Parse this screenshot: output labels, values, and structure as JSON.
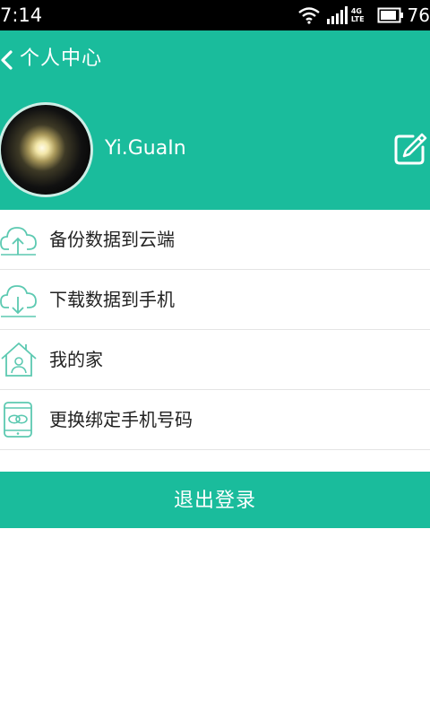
{
  "status_bar": {
    "time": "7:14",
    "network": "4G",
    "network_sub": "LTE",
    "battery": "76"
  },
  "header": {
    "title": "个人中心",
    "username": "Yi.GuaIn"
  },
  "menu": {
    "items": [
      {
        "label": "备份数据到云端",
        "icon": "cloud-upload-icon"
      },
      {
        "label": "下载数据到手机",
        "icon": "cloud-download-icon"
      },
      {
        "label": "我的家",
        "icon": "home-icon"
      },
      {
        "label": "更换绑定手机号码",
        "icon": "phone-link-icon"
      }
    ]
  },
  "logout_label": "退出登录",
  "colors": {
    "accent": "#1abc9c",
    "divider": "#e4e4e4"
  }
}
